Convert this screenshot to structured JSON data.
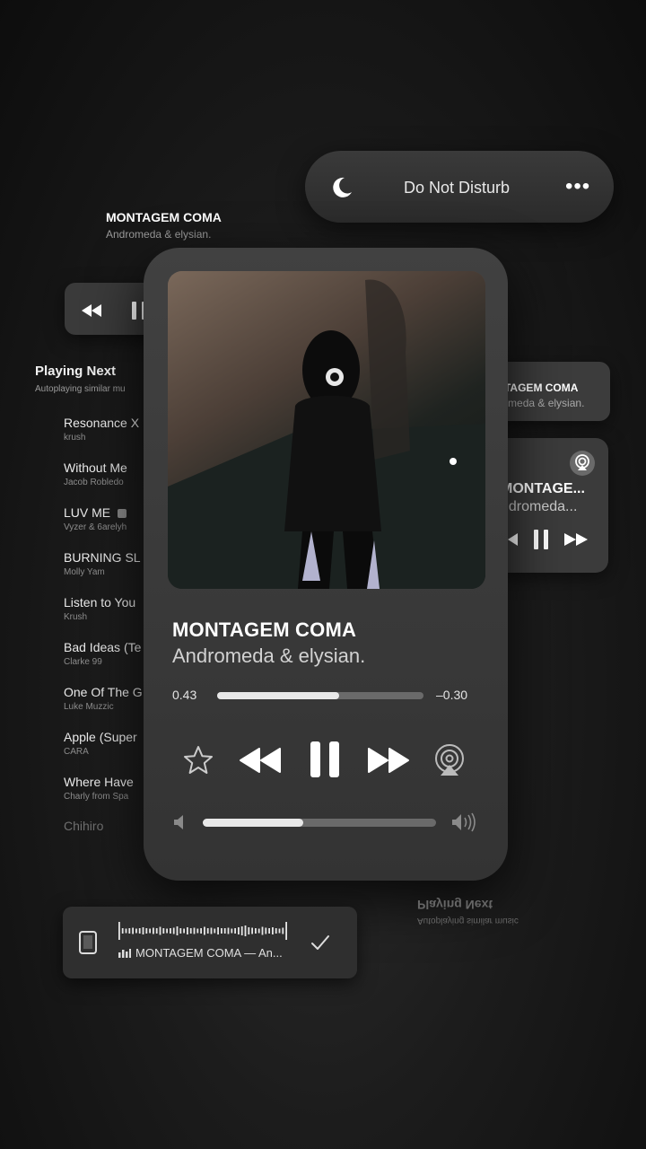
{
  "dnd": {
    "label": "Do Not Disturb",
    "more": "•••"
  },
  "top_left": {
    "title": "MONTAGEM COMA",
    "artist": "Andromeda & elysian."
  },
  "playing_next": {
    "title": "Playing Next",
    "subtitle": "Autoplaying similar mu",
    "items": [
      {
        "title": "Resonance X",
        "artist": "krush"
      },
      {
        "title": "Without Me",
        "artist": "Jacob Robledo"
      },
      {
        "title": "LUV ME",
        "artist": "Vyzer & 6arelyh"
      },
      {
        "title": "BURNING SL",
        "artist": "Molly Yam"
      },
      {
        "title": "Listen to You",
        "artist": "Krush"
      },
      {
        "title": "Bad Ideas (Te",
        "artist": "Clarke 99"
      },
      {
        "title": "One Of The G",
        "artist": "Luke Muzzic"
      },
      {
        "title": "Apple (Super",
        "artist": "CARA"
      },
      {
        "title": "Where Have",
        "artist": "Charly from Spa"
      }
    ],
    "last": "Chihiro"
  },
  "right_now_playing": {
    "title": "MONTAGEM COMA",
    "artist": "Andromeda & elysian."
  },
  "airplay_card": {
    "title": "MONTAGE...",
    "artist": "ndromeda..."
  },
  "player": {
    "title": "MONTAGEM COMA",
    "artist": "Andromeda & elysian.",
    "elapsed": "0.43",
    "remaining": "–0.30",
    "progress": 0.59,
    "volume": 0.43
  },
  "mirrored": {
    "title": "Playing Next",
    "subtitle": "Autoplaying similar music"
  },
  "bottom_pill": {
    "now_playing": "MONTAGEM COMA — An..."
  }
}
